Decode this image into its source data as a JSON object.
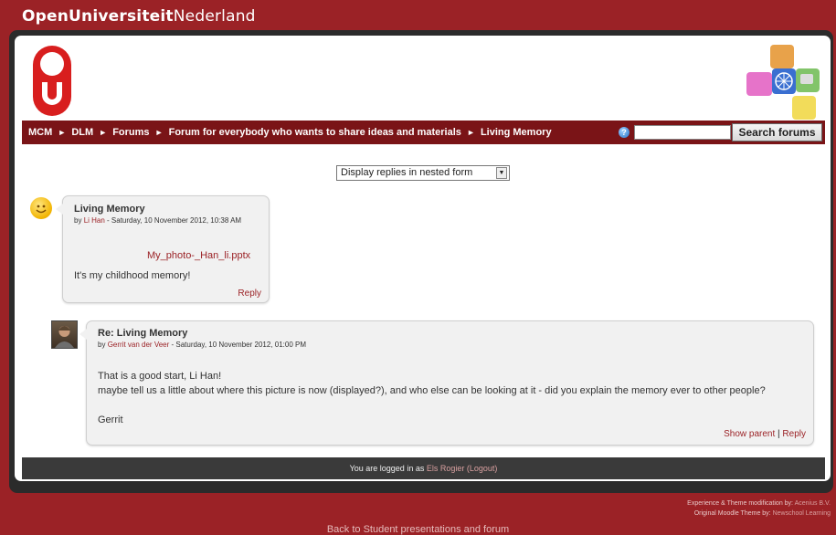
{
  "brand": {
    "bold": "OpenUniversiteit",
    "rest": "Nederland"
  },
  "breadcrumb": [
    {
      "label": "MCM"
    },
    {
      "label": "DLM"
    },
    {
      "label": "Forums"
    },
    {
      "label": "Forum for everybody who wants to share ideas and materials"
    },
    {
      "label": "Living Memory"
    }
  ],
  "breadcrumb_separator": "►",
  "search": {
    "button_label": "Search forums",
    "value": "",
    "help_icon": "question-icon"
  },
  "display_mode": {
    "selected": "Display replies in nested form"
  },
  "posts": [
    {
      "title": "Living Memory",
      "by": "by",
      "author": "Li Han",
      "date": " - Saturday, 10 November 2012, 10:38 AM",
      "attachment": "My_photo-_Han_li.pptx",
      "body": [
        "It's my childhood memory!"
      ],
      "commands": {
        "reply": "Reply"
      },
      "avatar": "smiley-avatar"
    },
    {
      "title": "Re: Living Memory",
      "by": "by",
      "author": "Gerrit van der Veer",
      "date": " - Saturday, 10 November 2012, 01:00 PM",
      "body": [
        "That is a good start, Li Han!",
        "maybe tell us a little about where this picture is now (displayed?), and who else can be looking at it - did you explain the memory ever to other people?",
        "Gerrit"
      ],
      "commands": {
        "show_parent": "Show parent",
        "separator": "|",
        "reply": "Reply"
      },
      "avatar": "user-photo"
    }
  ],
  "login": {
    "prefix": "You are logged in as ",
    "user": "Els Rogier",
    "logout": "(Logout)"
  },
  "credits": {
    "line1_prefix": "Experience & Theme modification by: ",
    "line1_link": "Acenius B.V.",
    "line2_prefix": "Original Moodle Theme by: ",
    "line2_link": "Newschool Learning"
  },
  "back_link": "Back to Student presentations and forum",
  "colors": {
    "brand_red": "#9b2226",
    "nav_dark_red": "#7a1417",
    "post_bg": "#f1f1f1"
  }
}
